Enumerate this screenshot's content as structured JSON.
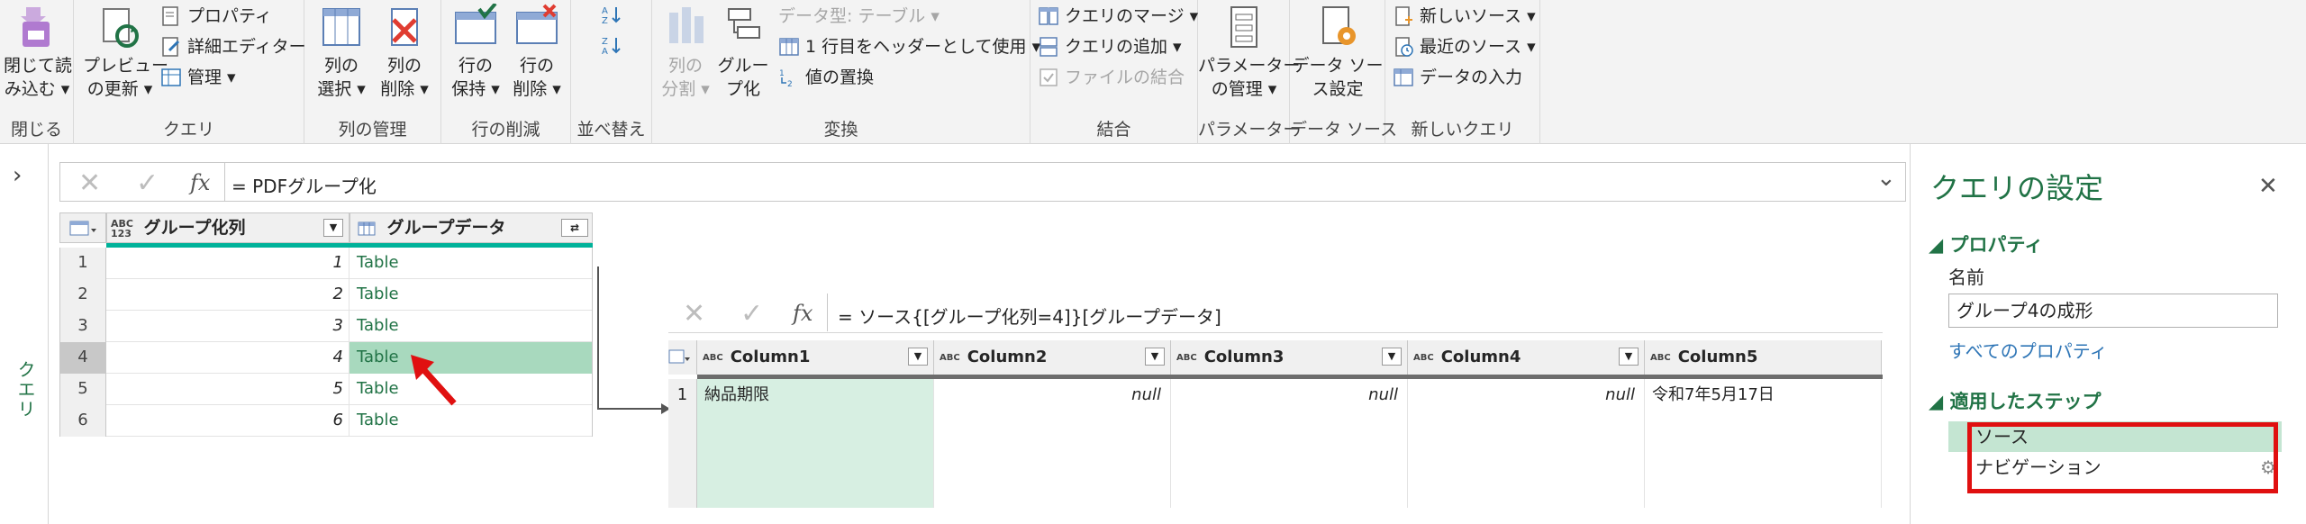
{
  "ribbon": {
    "groups": {
      "close": {
        "label": "閉じる",
        "btn_line1": "閉じて読",
        "btn_line2": "み込む ▾"
      },
      "query": {
        "label": "クエリ",
        "preview_line1": "プレビュー",
        "preview_line2": "の更新 ▾",
        "properties": "プロパティ",
        "advanced_editor": "詳細エディター",
        "manage": "管理 ▾"
      },
      "columns": {
        "label": "列の管理",
        "select_line1": "列の",
        "select_line2": "選択 ▾",
        "remove_line1": "列の",
        "remove_line2": "削除 ▾"
      },
      "rows": {
        "label": "行の削減",
        "keep_line1": "行の",
        "keep_line2": "保持 ▾",
        "remove_line1": "行の",
        "remove_line2": "削除 ▾"
      },
      "sort": {
        "label": "並べ替え"
      },
      "transform": {
        "label": "変換",
        "split_line1": "列の",
        "split_line2": "分割 ▾",
        "group_line1": "グルー",
        "group_line2": "プ化",
        "datatype": "データ型: テーブル ▾",
        "first_row_header": "1 行目をヘッダーとして使用 ▾",
        "replace_values": "値の置換"
      },
      "combine": {
        "label": "結合",
        "merge": "クエリのマージ ▾",
        "append": "クエリの追加 ▾",
        "combine_files": "ファイルの結合"
      },
      "parameters": {
        "label": "パラメーター",
        "manage_line1": "パラメーター",
        "manage_line2": "の管理 ▾"
      },
      "datasource": {
        "label": "データ ソース",
        "settings_line1": "データ ソー",
        "settings_line2": "ス設定"
      },
      "newquery": {
        "label": "新しいクエリ",
        "new_source": "新しいソース ▾",
        "recent_sources": "最近のソース ▾",
        "enter_data": "データの入力"
      }
    }
  },
  "leftnav": {
    "toggle": "›",
    "label": "クエリ"
  },
  "formula_bar": {
    "cancel": "✕",
    "commit": "✓",
    "fx": "fx",
    "text": "= PDFグループ化",
    "expand": "⌄"
  },
  "grid1": {
    "columns": [
      {
        "type": "ABC\n123",
        "name": "グループ化列"
      },
      {
        "type": "table",
        "name": "グループデータ"
      }
    ],
    "rows": [
      {
        "num": "1",
        "value": "1",
        "table": "Table"
      },
      {
        "num": "2",
        "value": "2",
        "table": "Table"
      },
      {
        "num": "3",
        "value": "3",
        "table": "Table"
      },
      {
        "num": "4",
        "value": "4",
        "table": "Table"
      },
      {
        "num": "5",
        "value": "5",
        "table": "Table"
      },
      {
        "num": "6",
        "value": "6",
        "table": "Table"
      }
    ],
    "selected_row": 3
  },
  "preview": {
    "formula": "= ソース{[グループ化列=4]}[グループデータ]",
    "columns": [
      "Column1",
      "Column2",
      "Column3",
      "Column4",
      "Column5"
    ],
    "row": {
      "num": "1",
      "cells": [
        "納品期限",
        "null",
        "null",
        "null",
        "令和7年5月17日"
      ]
    }
  },
  "settings": {
    "title": "クエリの設定",
    "close": "✕",
    "properties_header": "◢ プロパティ",
    "name_label": "名前",
    "name_value": "グループ4の成形",
    "all_properties": "すべてのプロパティ",
    "steps_header": "◢ 適用したステップ",
    "steps": [
      "ソース",
      "ナビゲーション"
    ],
    "gear": "⚙"
  },
  "colors": {
    "accent": "#217346",
    "teal": "#00b29a",
    "selected_cell": "#a8d9be",
    "highlight_box": "#e01010"
  }
}
